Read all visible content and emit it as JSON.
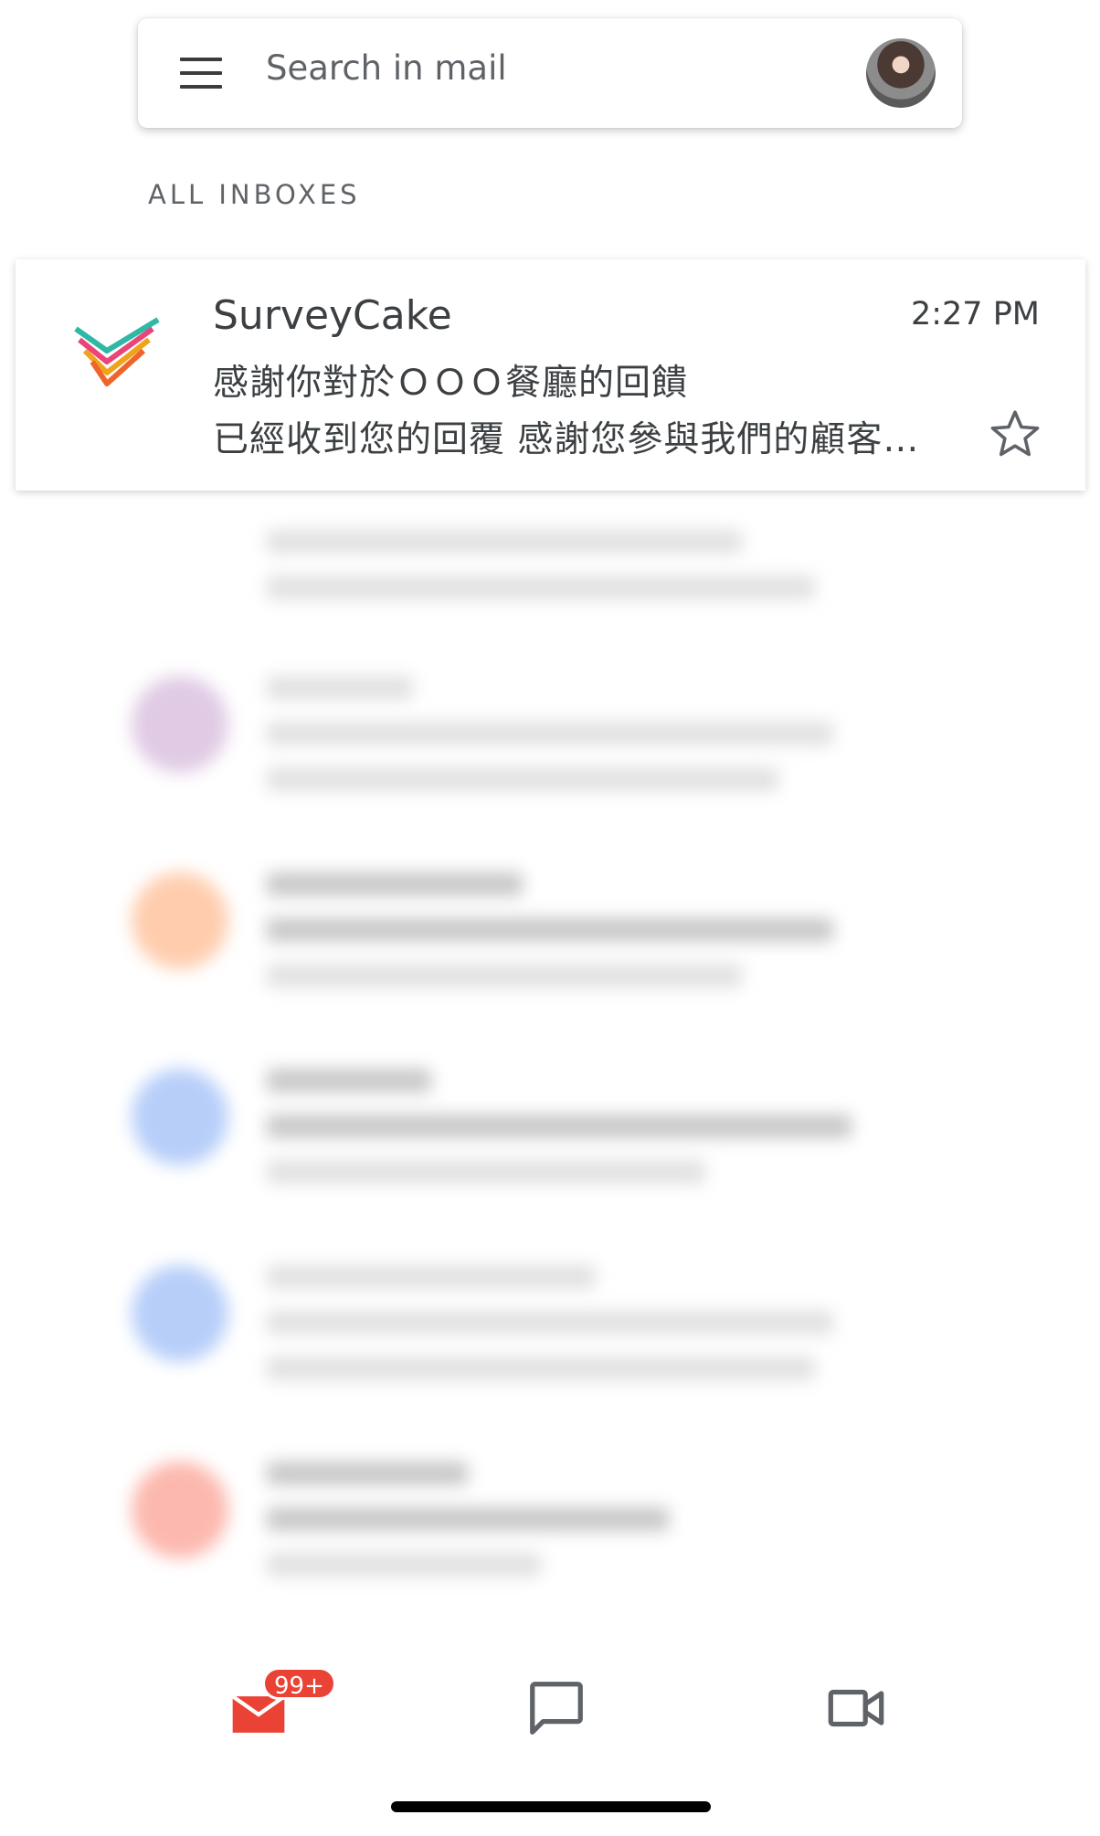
{
  "search": {
    "placeholder": "Search in mail"
  },
  "section_label": "ALL INBOXES",
  "email": {
    "sender": "SurveyCake",
    "time": "2:27 PM",
    "subject": "感謝你對於ＯＯＯ餐廳的回饋",
    "snippet": "已經收到您的回覆 感謝您參與我們的顧客滿意度調查",
    "starred": false
  },
  "bottom_nav": {
    "mail_badge": "99+",
    "tabs": [
      "mail-icon",
      "chat-icon",
      "video-icon"
    ]
  },
  "colors": {
    "accent": "#ea4335",
    "text": "#3c4043"
  }
}
